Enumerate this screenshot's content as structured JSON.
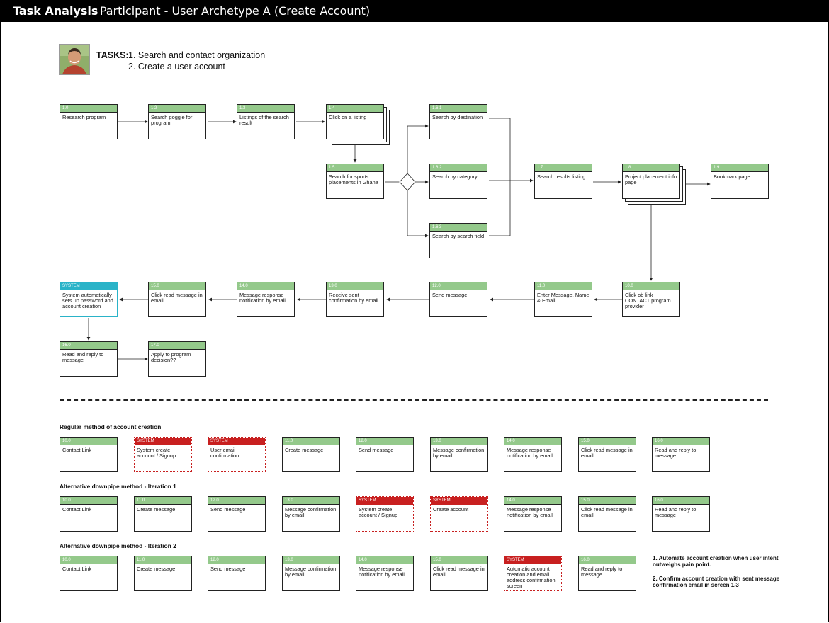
{
  "title": {
    "bold": "Task Analysis",
    "rest": " - Participant - User Archetype A   (Create Account)"
  },
  "tasks": {
    "label": "TASKS:",
    "task1": "1. Search and contact organization",
    "task2": "2. Create a user account"
  },
  "flow": [
    {
      "num": "1.0",
      "text": "Research program"
    },
    {
      "num": "1.2",
      "text": "Search goggle for program"
    },
    {
      "num": "1.3",
      "text": "Listings of the search result"
    },
    {
      "num": "1.4",
      "text": "Click on a listing"
    },
    {
      "num": "1.5",
      "text": "Search for sports placements in Ghana"
    },
    {
      "num": "1.6.1",
      "text": "Search by destination"
    },
    {
      "num": "1.6.2",
      "text": "Search by category"
    },
    {
      "num": "1.6.3",
      "text": "Search by search field"
    },
    {
      "num": "1.7",
      "text": "Search results listing"
    },
    {
      "num": "1.8",
      "text": "Project placement info page"
    },
    {
      "num": "1.9",
      "text": "Bookmark page"
    },
    {
      "num": "10.0",
      "text": "Click ob link CONTACT program provider"
    },
    {
      "num": "11.0",
      "text": "Enter Message, Name & Email"
    },
    {
      "num": "12.0",
      "text": "Send message"
    },
    {
      "num": "13.0",
      "text": "Receive sent confirmation by email"
    },
    {
      "num": "14.0",
      "text": "Message response notification by email"
    },
    {
      "num": "15.0",
      "text": "Click read message in email"
    },
    {
      "num": "SYSTEM",
      "text": "System automatically sets up password and account creation"
    },
    {
      "num": "16.0",
      "text": "Read and reply to message"
    },
    {
      "num": "17.0",
      "text": "Apply to program decision??"
    }
  ],
  "rows": [
    {
      "label": "Regular method of account creation",
      "boxes": [
        {
          "num": "10.0",
          "text": "Contact Link",
          "kind": "green"
        },
        {
          "num": "SYSTEM",
          "text": "System create account / Signup",
          "kind": "red"
        },
        {
          "num": "SYSTEM",
          "text": "User email confirmation",
          "kind": "red"
        },
        {
          "num": "11.0",
          "text": "Create message",
          "kind": "green"
        },
        {
          "num": "12.0",
          "text": "Send message",
          "kind": "green"
        },
        {
          "num": "13.0",
          "text": "Message confirmation by email",
          "kind": "green"
        },
        {
          "num": "14.0",
          "text": "Message response notification by email",
          "kind": "green"
        },
        {
          "num": "15.0",
          "text": "Click read message in email",
          "kind": "green"
        },
        {
          "num": "16.0",
          "text": "Read and reply to message",
          "kind": "green"
        }
      ]
    },
    {
      "label": "Alternative downpipe method - Iteration 1",
      "boxes": [
        {
          "num": "10.0",
          "text": "Contact Link",
          "kind": "green"
        },
        {
          "num": "11.0",
          "text": "Create message",
          "kind": "green"
        },
        {
          "num": "12.0",
          "text": "Send message",
          "kind": "green"
        },
        {
          "num": "13.0",
          "text": "Message confirmation by email",
          "kind": "green"
        },
        {
          "num": "SYSTEM",
          "text": "System create account / Signup",
          "kind": "red"
        },
        {
          "num": "SYSTEM",
          "text": "Create account",
          "kind": "red"
        },
        {
          "num": "14.0",
          "text": "Message response notification by email",
          "kind": "green"
        },
        {
          "num": "15.0",
          "text": "Click read message in email",
          "kind": "green"
        },
        {
          "num": "16.0",
          "text": "Read and reply to message",
          "kind": "green"
        }
      ]
    },
    {
      "label": "Alternative downpipe method - Iteration 2",
      "boxes": [
        {
          "num": "10.0",
          "text": "Contact Link",
          "kind": "green"
        },
        {
          "num": "11.0",
          "text": "Create message",
          "kind": "green"
        },
        {
          "num": "12.0",
          "text": "Send message",
          "kind": "green"
        },
        {
          "num": "13.0",
          "text": "Message confirmation by email",
          "kind": "green"
        },
        {
          "num": "14.0",
          "text": "Message response notification by email",
          "kind": "green"
        },
        {
          "num": "15.0",
          "text": "Click read message in email",
          "kind": "green"
        },
        {
          "num": "SYSTEM",
          "text": "Automatic account creation and email address confirmation screen",
          "kind": "red"
        },
        {
          "num": "16.0",
          "text": " Read and reply to message",
          "kind": "green"
        }
      ]
    }
  ],
  "notes": {
    "n1": "1. Automate account creation when user intent outweighs pain point.",
    "n2": "2. Confirm account creation with sent message confirmation email in screen 1.3"
  },
  "colors": {
    "green": "#94c98b",
    "red": "#c82020",
    "blue": "#2ab3c8"
  }
}
